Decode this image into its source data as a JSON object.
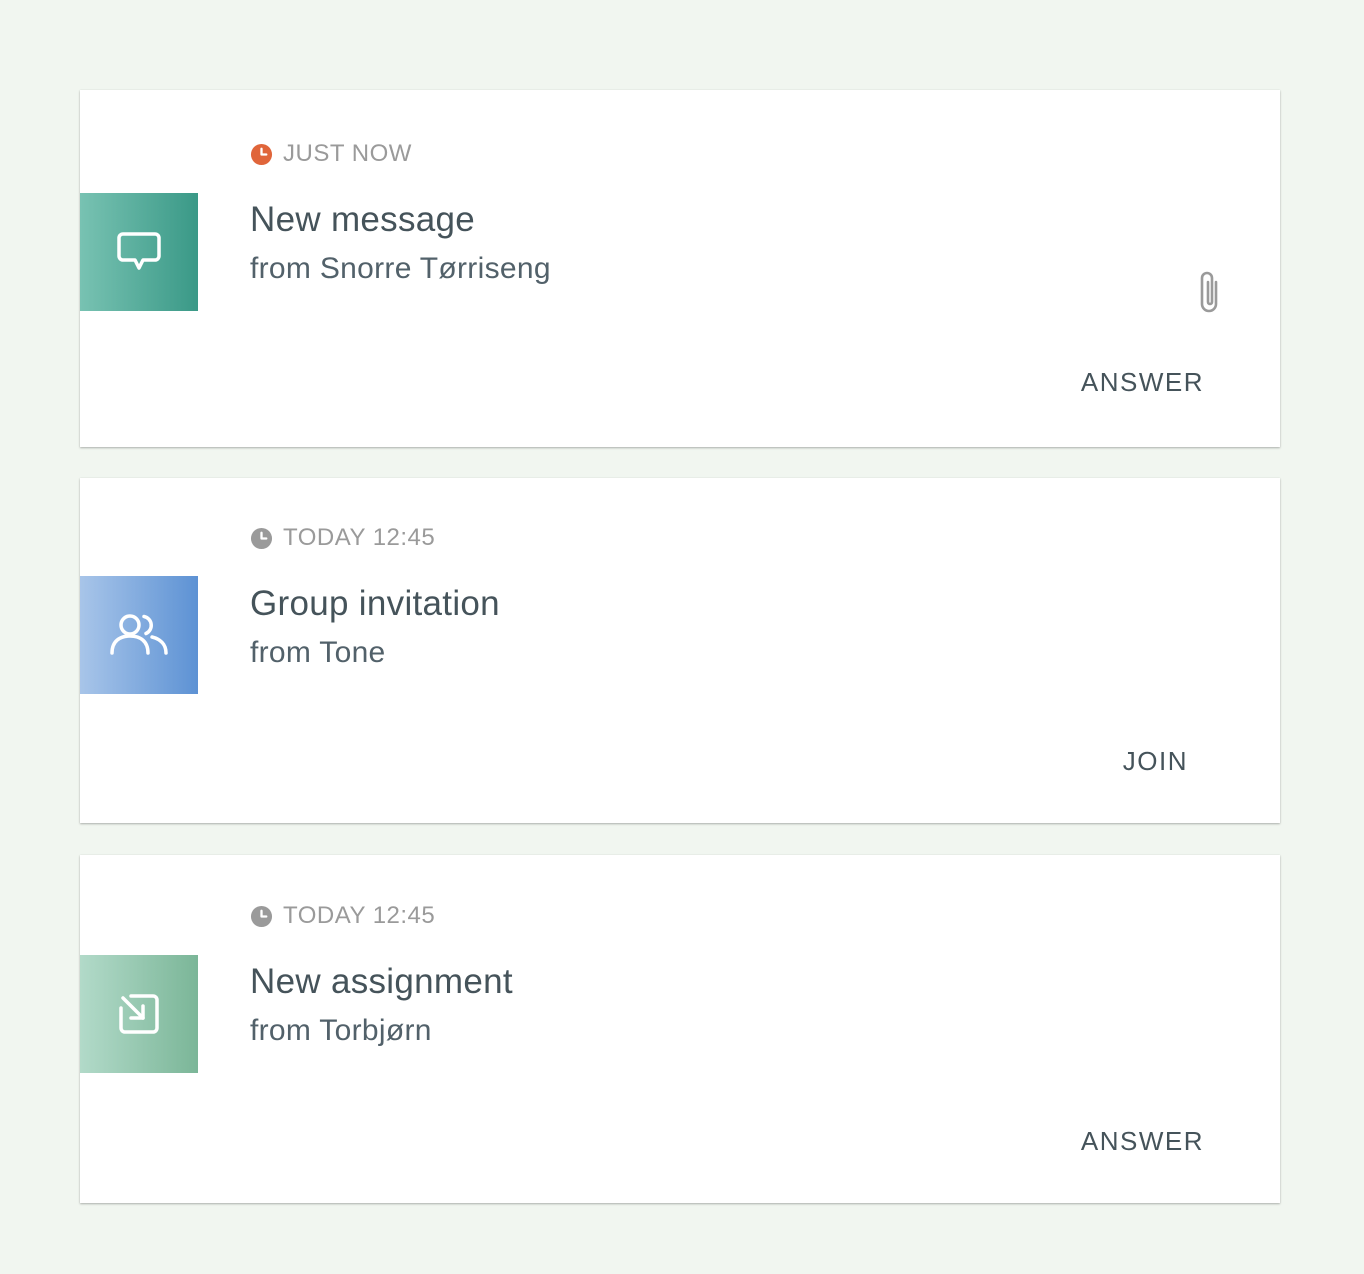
{
  "colors": {
    "background": "#f1f6f0",
    "recent_clock": "#e0653a",
    "past_clock": "#9a9a9a",
    "message_tile": "#3a9987",
    "group_tile": "#5d92d4",
    "assignment_tile": "#7bb698"
  },
  "notifications": [
    {
      "time": "JUST NOW",
      "title": "New message",
      "from": "from Snorre Tørriseng",
      "action": "ANSWER",
      "icon": "chat-bubble-icon",
      "has_attachment": true
    },
    {
      "time": "TODAY 12:45",
      "title": "Group invitation",
      "from": "from Tone",
      "action": "JOIN",
      "icon": "group-icon",
      "has_attachment": false
    },
    {
      "time": "TODAY 12:45",
      "title": "New assignment",
      "from": "from Torbjørn",
      "action": "ANSWER",
      "icon": "assignment-arrow-icon",
      "has_attachment": false
    }
  ]
}
